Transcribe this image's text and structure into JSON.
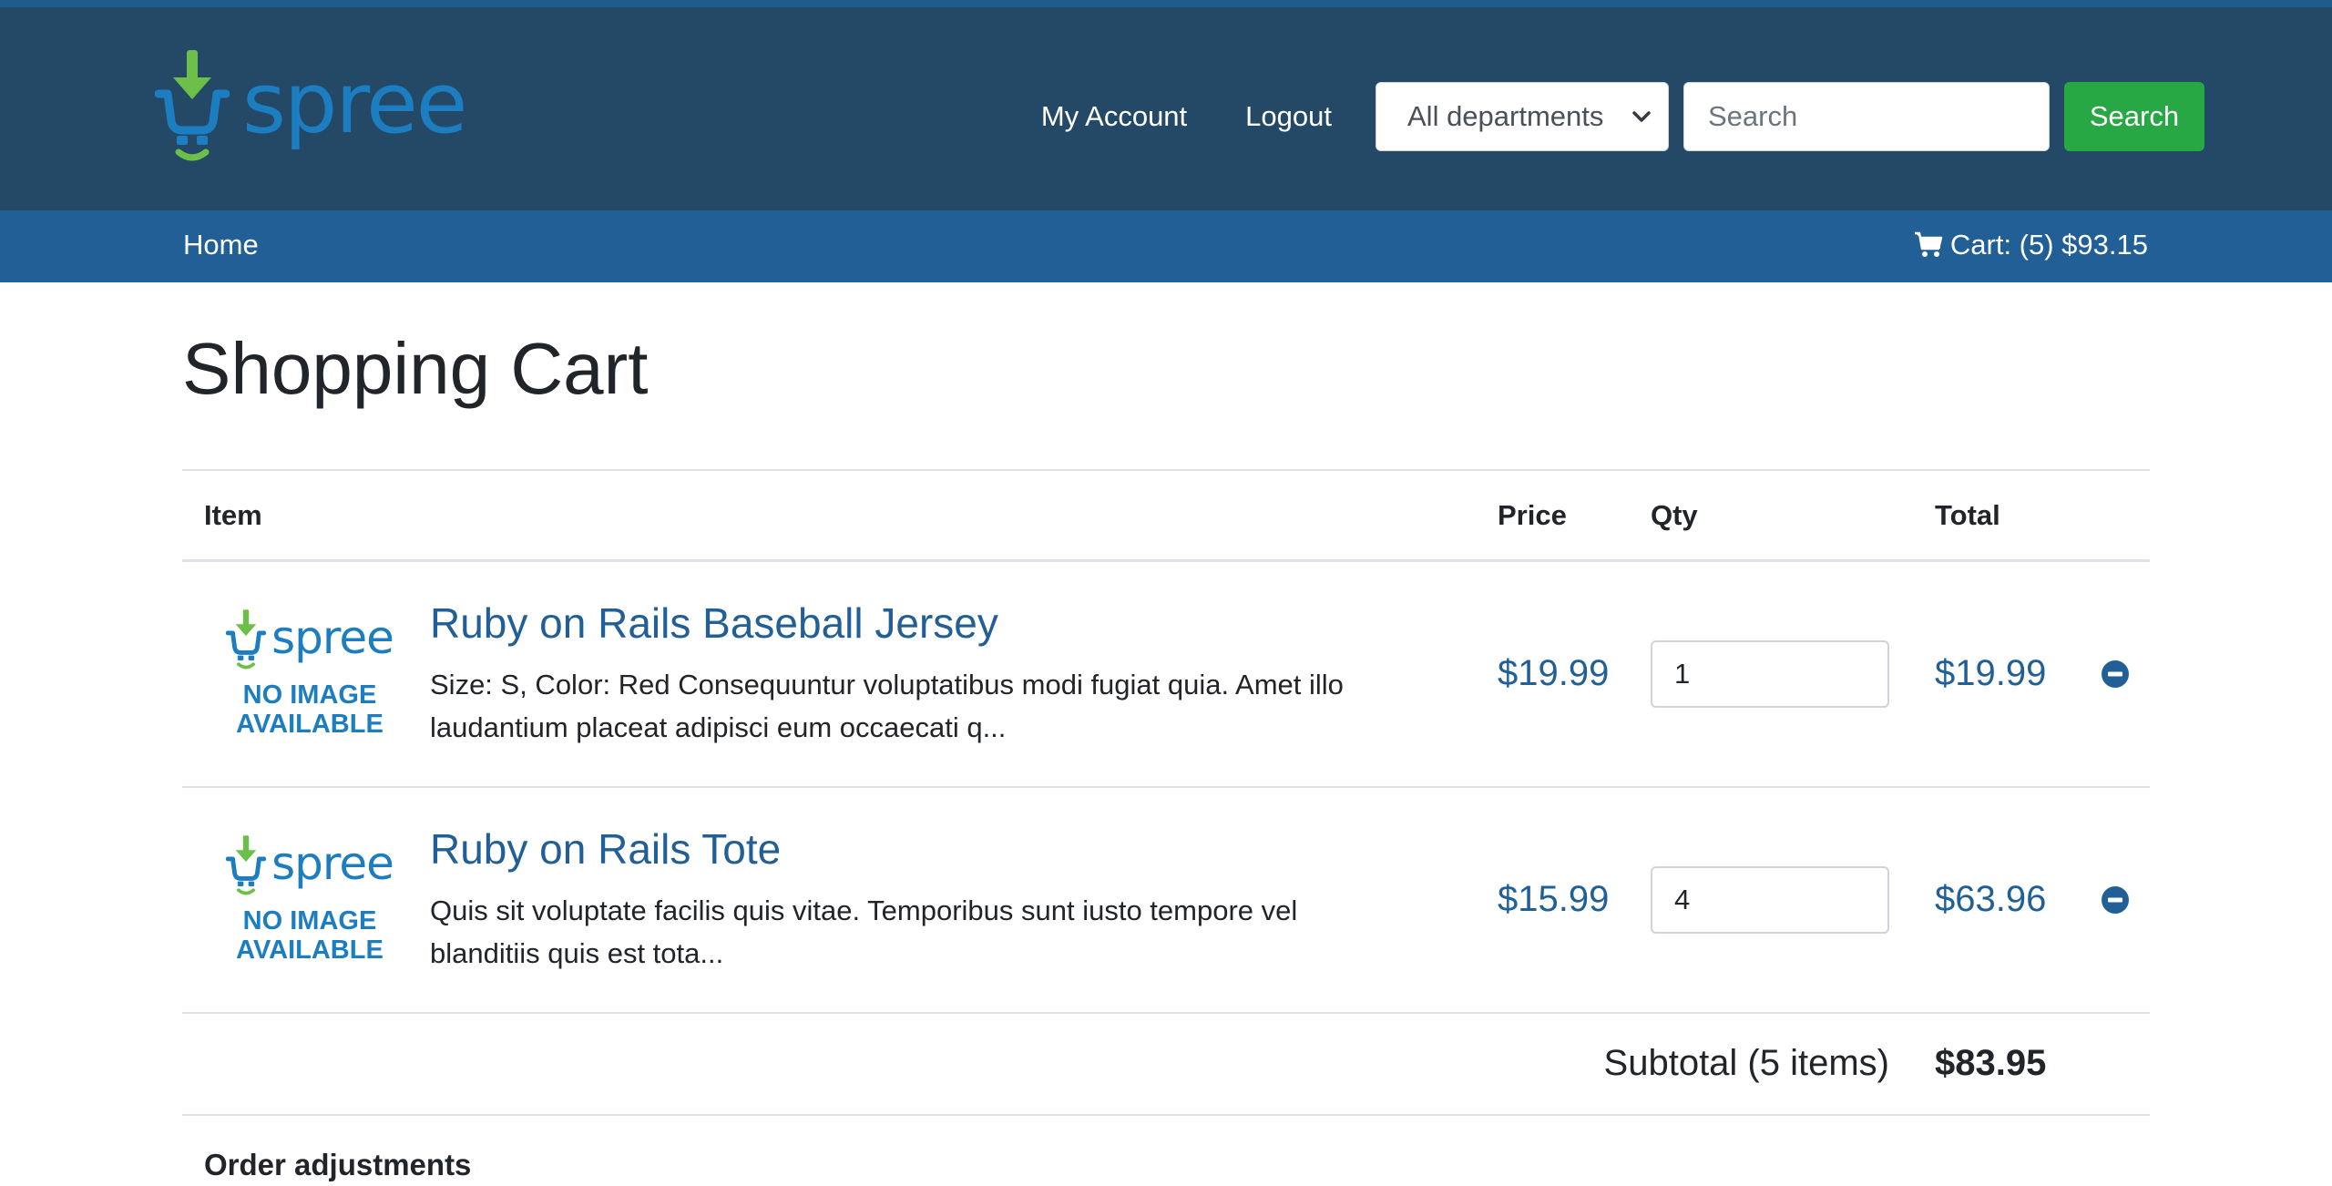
{
  "brand": {
    "name": "spree",
    "green": "#6cc04a",
    "blue": "#1c7dc0"
  },
  "header": {
    "my_account": "My Account",
    "logout": "Logout",
    "department_selected": "All departments",
    "search_placeholder": "Search",
    "search_button": "Search"
  },
  "subnav": {
    "home": "Home",
    "cart_label": "Cart: (5) $93.15"
  },
  "page": {
    "title": "Shopping Cart"
  },
  "cart": {
    "columns": {
      "item": "Item",
      "price": "Price",
      "qty": "Qty",
      "total": "Total"
    },
    "no_image_line1": "NO IMAGE",
    "no_image_line2": "AVAILABLE",
    "items": [
      {
        "name": "Ruby on Rails Baseball Jersey",
        "description": "Size: S, Color: Red Consequuntur voluptatibus modi fugiat quia. Amet illo laudantium placeat adipisci eum occaecati q...",
        "price": "$19.99",
        "qty": "1",
        "total": "$19.99"
      },
      {
        "name": "Ruby on Rails Tote",
        "description": "Quis sit voluptate facilis quis vitae. Temporibus sunt iusto tempore vel blanditiis quis est tota...",
        "price": "$15.99",
        "qty": "4",
        "total": "$63.96"
      }
    ],
    "subtotal_label": "Subtotal (5 items)",
    "subtotal_value": "$83.95",
    "adjustments_heading": "Order adjustments"
  }
}
